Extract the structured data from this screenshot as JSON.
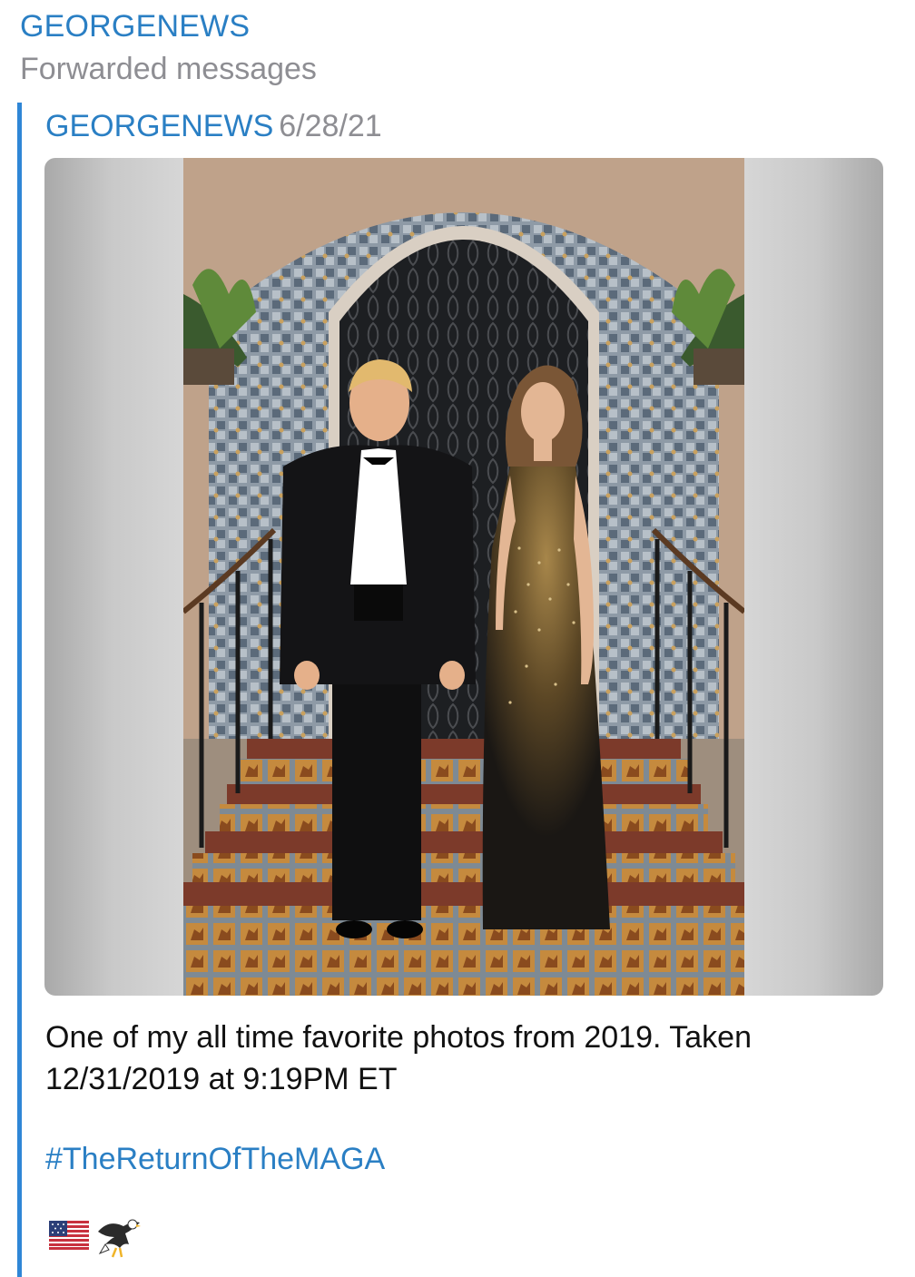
{
  "channel": {
    "title": "GEORGENEWS",
    "subtitle": "Forwarded messages"
  },
  "message": {
    "author": "GEORGENEWS",
    "date": "6/28/21",
    "caption": "One of my all time favorite photos from 2019. Taken 12/31/2019 at 9:19PM ET",
    "hashtag": "#TheReturnOfTheMAGA",
    "emojis": [
      "us-flag-icon",
      "eagle-icon"
    ]
  },
  "colors": {
    "accent": "#2a7fc4",
    "quote_bar": "#2f86d6",
    "muted": "#8e8e93",
    "text": "#111111"
  }
}
